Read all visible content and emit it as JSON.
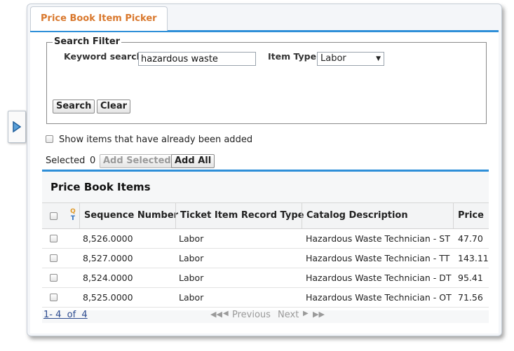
{
  "window": {
    "tab_title": "Price Book Item Picker"
  },
  "filter": {
    "legend": "Search Filter",
    "keyword_label": "Keyword search:",
    "keyword_value": "hazardous waste",
    "item_type_label": "Item Type:",
    "item_type_value": "Labor",
    "search_label": "Search",
    "clear_label": "Clear"
  },
  "show_added_label": "Show items that have already been added",
  "selection": {
    "selected_label": "Selected",
    "selected_count": "0",
    "add_selected_label": "Add Selected",
    "add_all_label": "Add All"
  },
  "table": {
    "title": "Price Book Items",
    "qt_icon_text": "Q\nT",
    "columns": {
      "sequence": "Sequence Number",
      "record_type": "Ticket Item Record Type",
      "catalog": "Catalog Description",
      "price": "Price"
    },
    "rows": [
      {
        "sequence": "8,526.0000",
        "record_type": "Labor",
        "catalog": "Hazardous Waste Technician - ST",
        "price": "47.70"
      },
      {
        "sequence": "8,527.0000",
        "record_type": "Labor",
        "catalog": "Hazardous Waste Technician - TT",
        "price": "143.11"
      },
      {
        "sequence": "8,524.0000",
        "record_type": "Labor",
        "catalog": "Hazardous Waste Technician - DT",
        "price": "95.41"
      },
      {
        "sequence": "8,525.0000",
        "record_type": "Labor",
        "catalog": "Hazardous Waste Technician - OT",
        "price": "71.56"
      }
    ]
  },
  "pager": {
    "range": "1- 4  of  4",
    "previous": "Previous",
    "next": "Next"
  },
  "colors": {
    "accent_blue": "#2e8fd8",
    "tab_orange": "#d9782d"
  },
  "icons": [
    "expand-arrow-icon",
    "qt-sort-icon",
    "first-page-icon",
    "prev-page-icon",
    "next-page-icon",
    "last-page-icon",
    "dropdown-arrow-icon"
  ]
}
